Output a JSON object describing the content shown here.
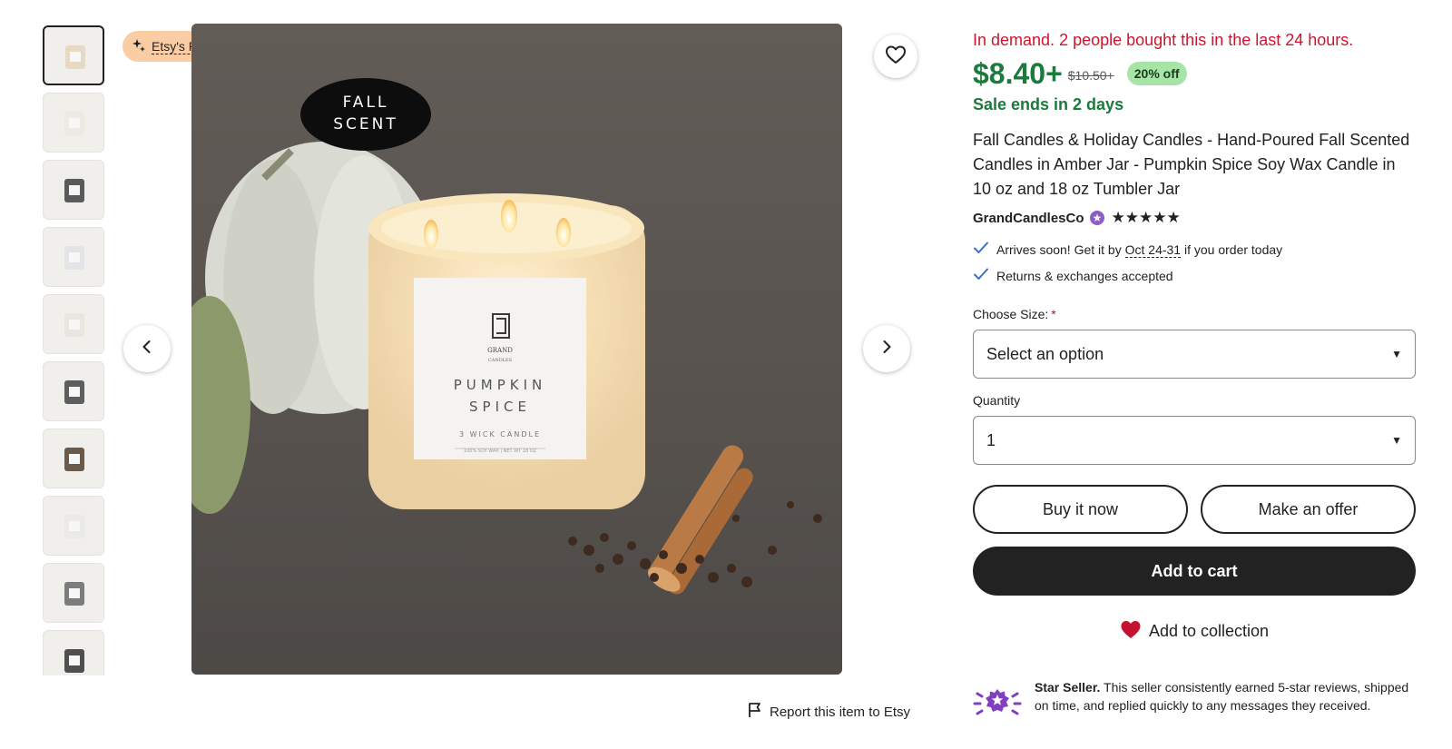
{
  "thumbnails": [
    {
      "name": "thumb-1",
      "jar": "#e8d9c4"
    },
    {
      "name": "thumb-2",
      "jar": "#ede9e3"
    },
    {
      "name": "thumb-3",
      "jar": "#5b5b5b"
    },
    {
      "name": "thumb-4",
      "jar": "#e4e4e7"
    },
    {
      "name": "thumb-5",
      "jar": "#e9e6df"
    },
    {
      "name": "thumb-6",
      "jar": "#5e5e5e"
    },
    {
      "name": "thumb-7",
      "jar": "#6a5a4c"
    },
    {
      "name": "thumb-8",
      "jar": "#eceae6"
    },
    {
      "name": "thumb-9",
      "jar": "#7c7c7c"
    },
    {
      "name": "thumb-10",
      "jar": "#4f4f4f"
    }
  ],
  "image": {
    "badge_line1": "FALL",
    "badge_line2": "SCENT",
    "label_brand": "GRAND",
    "label_brand_sub": "CANDLES",
    "label_name1": "PUMPKIN",
    "label_name2": "SPICE",
    "label_sub": "3 WICK CANDLE",
    "label_footer": "100% SOY WAX | NET WT 18 OZ"
  },
  "etsy_pick": {
    "label": "Etsy's Pick"
  },
  "report": {
    "label": "Report this item to Etsy"
  },
  "listing": {
    "demand": "In demand. 2 people bought this in the last 24 hours.",
    "price": "$8.40+",
    "original_price": "$10.50+",
    "discount": "20% off",
    "sale_ends": "Sale ends in 2 days",
    "title": "Fall Candles & Holiday Candles - Hand-Poured Fall Scented Candles in Amber Jar - Pumpkin Spice Soy Wax Candle in 10 oz and 18 oz Tumbler Jar",
    "seller": "GrandCandlesCo",
    "stars": "★★★★★"
  },
  "delivery": {
    "arrives_prefix": "Arrives soon! Get it by ",
    "arrives_date": "Oct 24-31",
    "arrives_suffix": " if you order today",
    "returns": "Returns & exchanges accepted"
  },
  "size": {
    "label": "Choose Size:",
    "required": "*",
    "value": "Select an option"
  },
  "quantity": {
    "label": "Quantity",
    "value": "1"
  },
  "buttons": {
    "buy_now": "Buy it now",
    "offer": "Make an offer",
    "cart": "Add to cart",
    "collection": "Add to collection"
  },
  "star_seller": {
    "title": "Star Seller.",
    "text": " This seller consistently earned 5-star reviews, shipped on time, and replied quickly to any messages they received."
  },
  "colors": {
    "sale_green": "#1b7a3c",
    "demand_red": "#d0142b",
    "discount_bg": "#a7e4a8",
    "pick_bg": "#fbcda5",
    "star_seller_purple": "#7f3fbf",
    "heart_red": "#c41230"
  }
}
